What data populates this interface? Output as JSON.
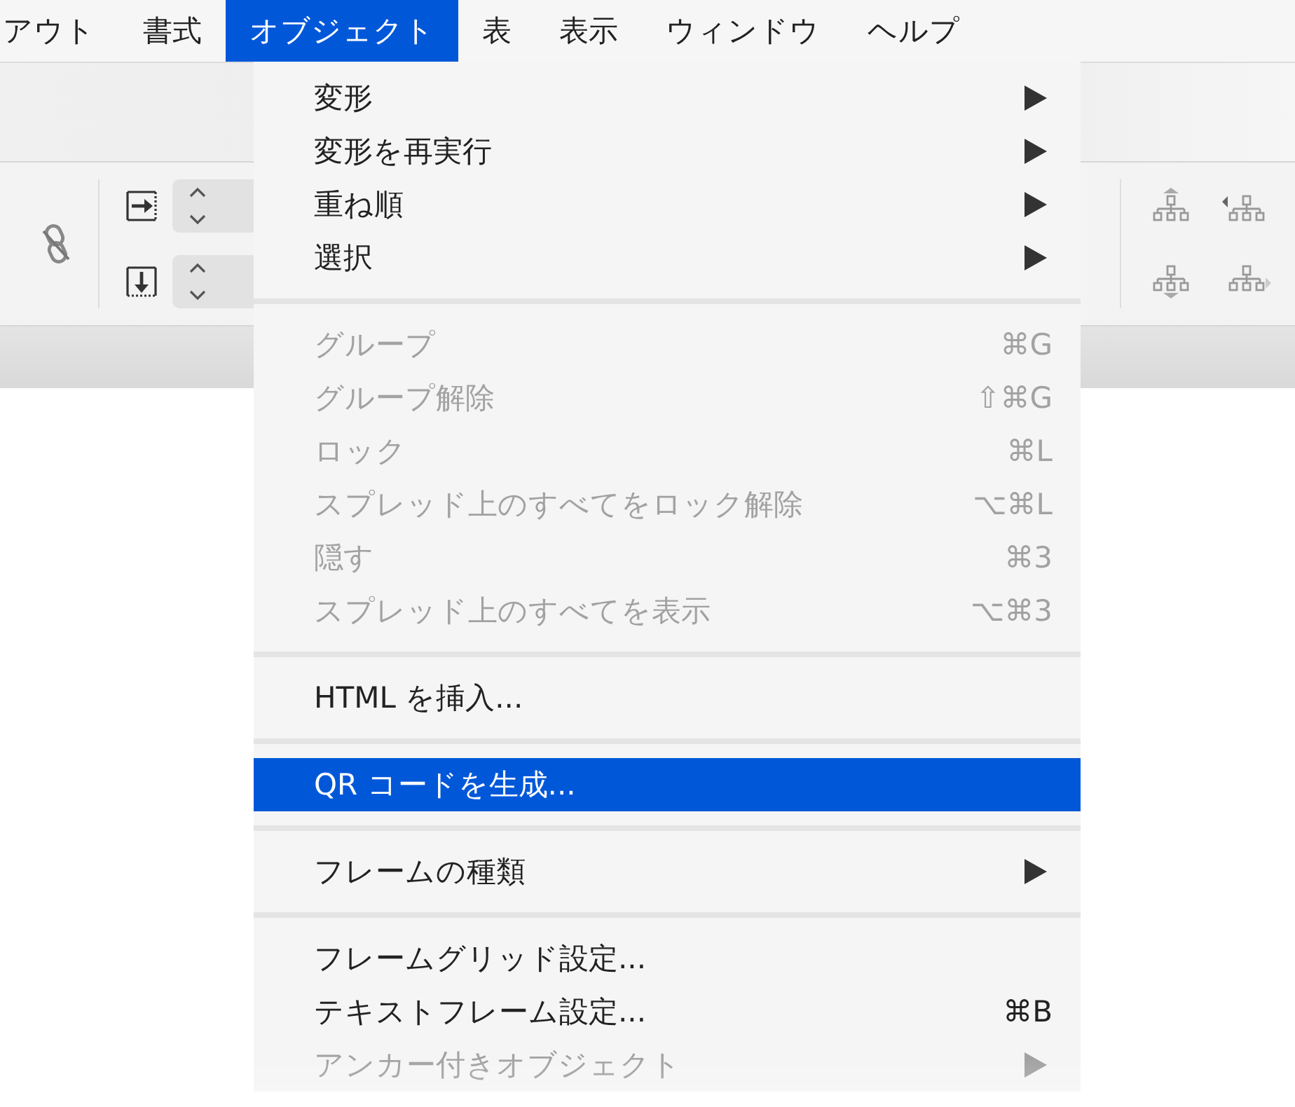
{
  "menubar": {
    "items": [
      {
        "label": "アウト",
        "selected": false
      },
      {
        "label": "書式",
        "selected": false
      },
      {
        "label": "オブジェクト",
        "selected": true
      },
      {
        "label": "表",
        "selected": false
      },
      {
        "label": "表示",
        "selected": false
      },
      {
        "label": "ウィンドウ",
        "selected": false
      },
      {
        "label": "ヘルプ",
        "selected": false
      }
    ]
  },
  "menu": {
    "items": [
      {
        "kind": "item",
        "label": "変形",
        "submenu": true,
        "disabled": false,
        "selected": false
      },
      {
        "kind": "item",
        "label": "変形を再実行",
        "submenu": true,
        "disabled": false,
        "selected": false
      },
      {
        "kind": "item",
        "label": "重ね順",
        "submenu": true,
        "disabled": false,
        "selected": false
      },
      {
        "kind": "item",
        "label": "選択",
        "submenu": true,
        "disabled": false,
        "selected": false
      },
      {
        "kind": "separator"
      },
      {
        "kind": "item",
        "label": "グループ",
        "shortcut": "⌘G",
        "disabled": true,
        "selected": false
      },
      {
        "kind": "item",
        "label": "グループ解除",
        "shortcut": "⇧⌘G",
        "disabled": true,
        "selected": false
      },
      {
        "kind": "item",
        "label": "ロック",
        "shortcut": "⌘L",
        "disabled": true,
        "selected": false
      },
      {
        "kind": "item",
        "label": "スプレッド上のすべてをロック解除",
        "shortcut": "⌥⌘L",
        "disabled": true,
        "selected": false
      },
      {
        "kind": "item",
        "label": "隠す",
        "shortcut": "⌘3",
        "disabled": true,
        "selected": false
      },
      {
        "kind": "item",
        "label": "スプレッド上のすべてを表示",
        "shortcut": "⌥⌘3",
        "disabled": true,
        "selected": false
      },
      {
        "kind": "separator"
      },
      {
        "kind": "item",
        "label": "HTML を挿入...",
        "disabled": false,
        "selected": false
      },
      {
        "kind": "separator"
      },
      {
        "kind": "item",
        "label": "QR コードを生成...",
        "disabled": false,
        "selected": true
      },
      {
        "kind": "separator"
      },
      {
        "kind": "item",
        "label": "フレームの種類",
        "submenu": true,
        "disabled": false,
        "selected": false
      },
      {
        "kind": "separator"
      },
      {
        "kind": "item",
        "label": "フレームグリッド設定...",
        "disabled": false,
        "selected": false
      },
      {
        "kind": "item",
        "label": "テキストフレーム設定...",
        "shortcut": "⌘B",
        "disabled": false,
        "selected": false
      },
      {
        "kind": "item",
        "label": "アンカー付きオブジェクト",
        "submenu": true,
        "disabled": true,
        "selected": false
      }
    ]
  }
}
